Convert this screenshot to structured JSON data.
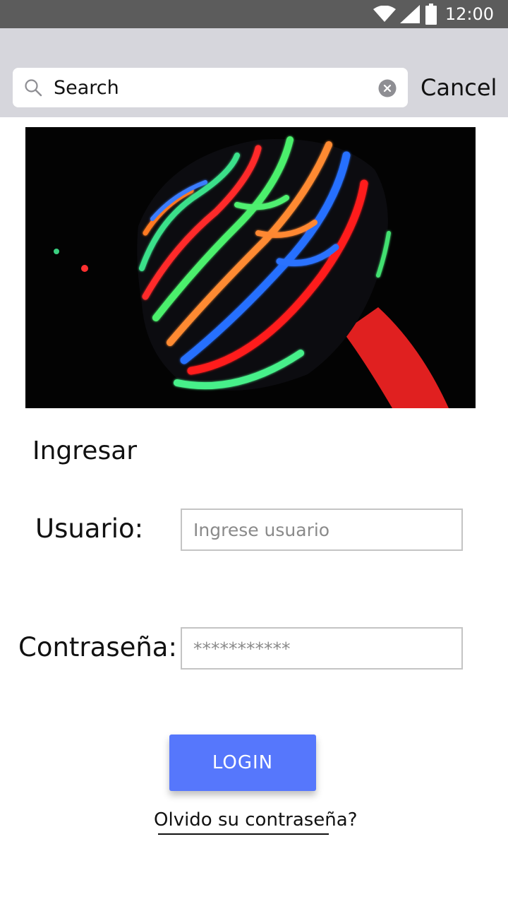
{
  "status_bar": {
    "time": "12:00",
    "icons": [
      "wifi-icon",
      "cell-signal-icon",
      "battery-icon"
    ]
  },
  "search": {
    "placeholder": "Search",
    "value": "",
    "cancel_label": "Cancel",
    "icons": [
      "search-icon",
      "clear-icon"
    ]
  },
  "hero_image": {
    "description_icon": "neon-stripes-image"
  },
  "login_form": {
    "title": "Ingresar",
    "user_label": "Usuario:",
    "user_placeholder": "Ingrese usuario",
    "password_label": "Contraseña:",
    "password_placeholder": "***********",
    "login_button": "LOGIN",
    "forgot_link": "Olvido su contraseña?"
  },
  "colors": {
    "status_bar": "#5c5c5c",
    "search_bar": "#d6d6dc",
    "accent": "#5677fc",
    "field_border": "#c4c4c4"
  }
}
